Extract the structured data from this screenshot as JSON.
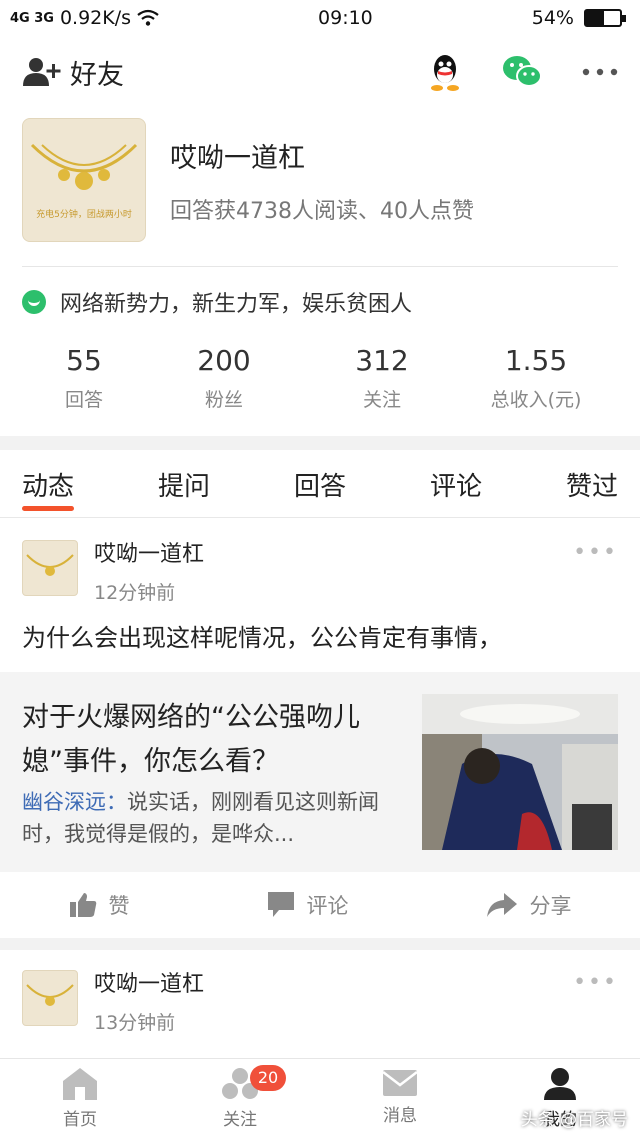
{
  "status_bar": {
    "signal": "4G 3G",
    "speed": "0.92K/s",
    "time": "09:10",
    "battery": "54%",
    "battery_level": 0.54
  },
  "top_nav": {
    "friends_label": "好友"
  },
  "profile": {
    "name": "哎呦一道杠",
    "stats": "回答获4738人阅读、40人点赞",
    "avatar_caption": "充电5分钟，团战两小时",
    "bio": "网络新势力，新生力军，娱乐贫困人"
  },
  "counts": [
    {
      "value": "55",
      "label": "回答"
    },
    {
      "value": "200",
      "label": "粉丝"
    },
    {
      "value": "312",
      "label": "关注"
    },
    {
      "value": "1.55",
      "label": "总收入(元)"
    }
  ],
  "tabs": [
    "动态",
    "提问",
    "回答",
    "评论",
    "赞过"
  ],
  "feed": [
    {
      "name": "哎呦一道杠",
      "time": "12分钟前",
      "text": "为什么会出现这样呢情况，公公肯定有事情，",
      "quote": {
        "title": "对于火爆网络的“公公强吻儿媳”事件，你怎么看？",
        "author": "幽谷深远：",
        "excerpt": "说实话，刚刚看见这则新闻时，我觉得是假的，是哗众..."
      }
    },
    {
      "name": "哎呦一道杠",
      "time": "13分钟前"
    }
  ],
  "actions": {
    "like": "赞",
    "comment": "评论",
    "share": "分享"
  },
  "bottom_bar": {
    "home": "首页",
    "follow": "关注",
    "follow_badge": "20",
    "messages": "消息",
    "mine": "我的",
    "watermark": "头条 @百家号"
  },
  "colors": {
    "accent": "#f3522b",
    "link": "#3e6bb5",
    "badge": "#f0503a",
    "wechat": "#2dbf6c"
  }
}
